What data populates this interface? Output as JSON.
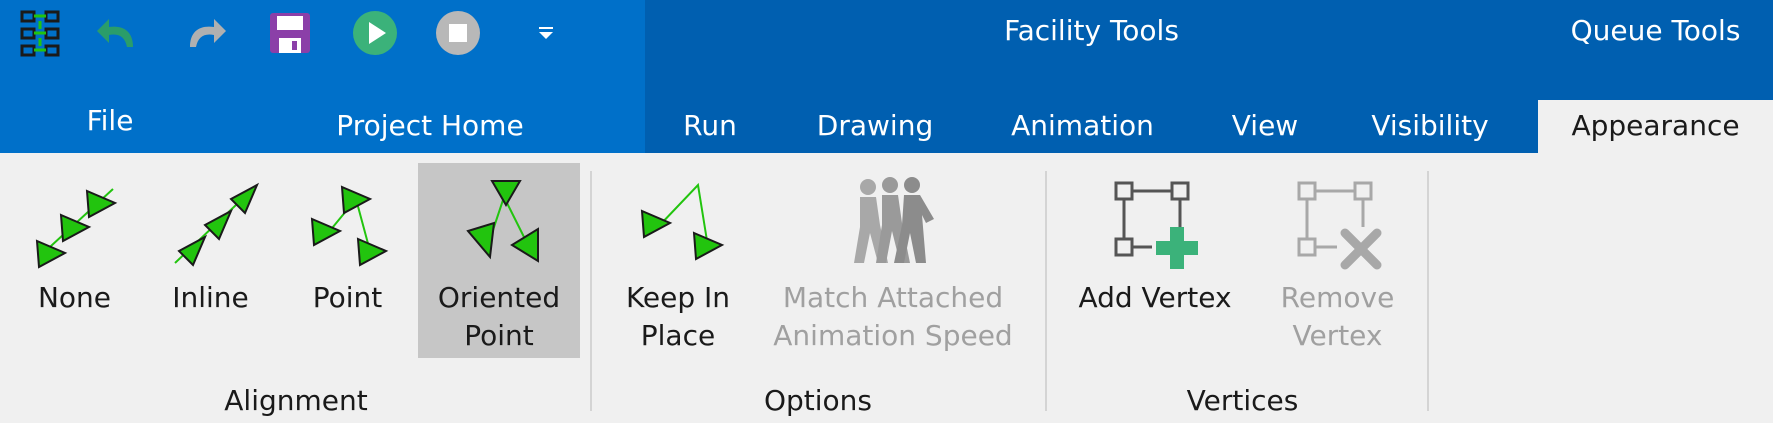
{
  "contextual": {
    "facility_tools": "Facility Tools",
    "queue_tools": "Queue Tools"
  },
  "quick_access": {
    "icons": [
      "app-logo-icon",
      "undo-icon",
      "redo-icon",
      "save-icon",
      "run-icon",
      "stop-icon",
      "customize-dropdown-icon"
    ]
  },
  "tabs": [
    {
      "label": "File"
    },
    {
      "label": "Project Home"
    },
    {
      "label": "Run"
    },
    {
      "label": "Drawing"
    },
    {
      "label": "Animation"
    },
    {
      "label": "View"
    },
    {
      "label": "Visibility"
    },
    {
      "label": "Appearance",
      "active": true
    }
  ],
  "groups": {
    "alignment": {
      "label": "Alignment",
      "buttons": [
        {
          "label": "None"
        },
        {
          "label": "Inline"
        },
        {
          "label": "Point"
        },
        {
          "label": "Oriented\nPoint",
          "selected": true
        }
      ]
    },
    "options": {
      "label": "Options",
      "buttons": [
        {
          "label": "Keep In\nPlace"
        },
        {
          "label": "Match Attached\nAnimation Speed",
          "disabled": true
        }
      ]
    },
    "vertices": {
      "label": "Vertices",
      "buttons": [
        {
          "label": "Add Vertex"
        },
        {
          "label": "Remove\nVertex",
          "disabled": true
        }
      ]
    }
  },
  "colors": {
    "tab_bar": "#0070c9",
    "contextual_bar": "#005fb0",
    "ribbon_bg": "#f0f0f0",
    "selected_bg": "#c6c6c6",
    "arrow_green": "#22c40e",
    "add_green": "#3bb27a",
    "disabled_text": "#a0a0a0"
  }
}
